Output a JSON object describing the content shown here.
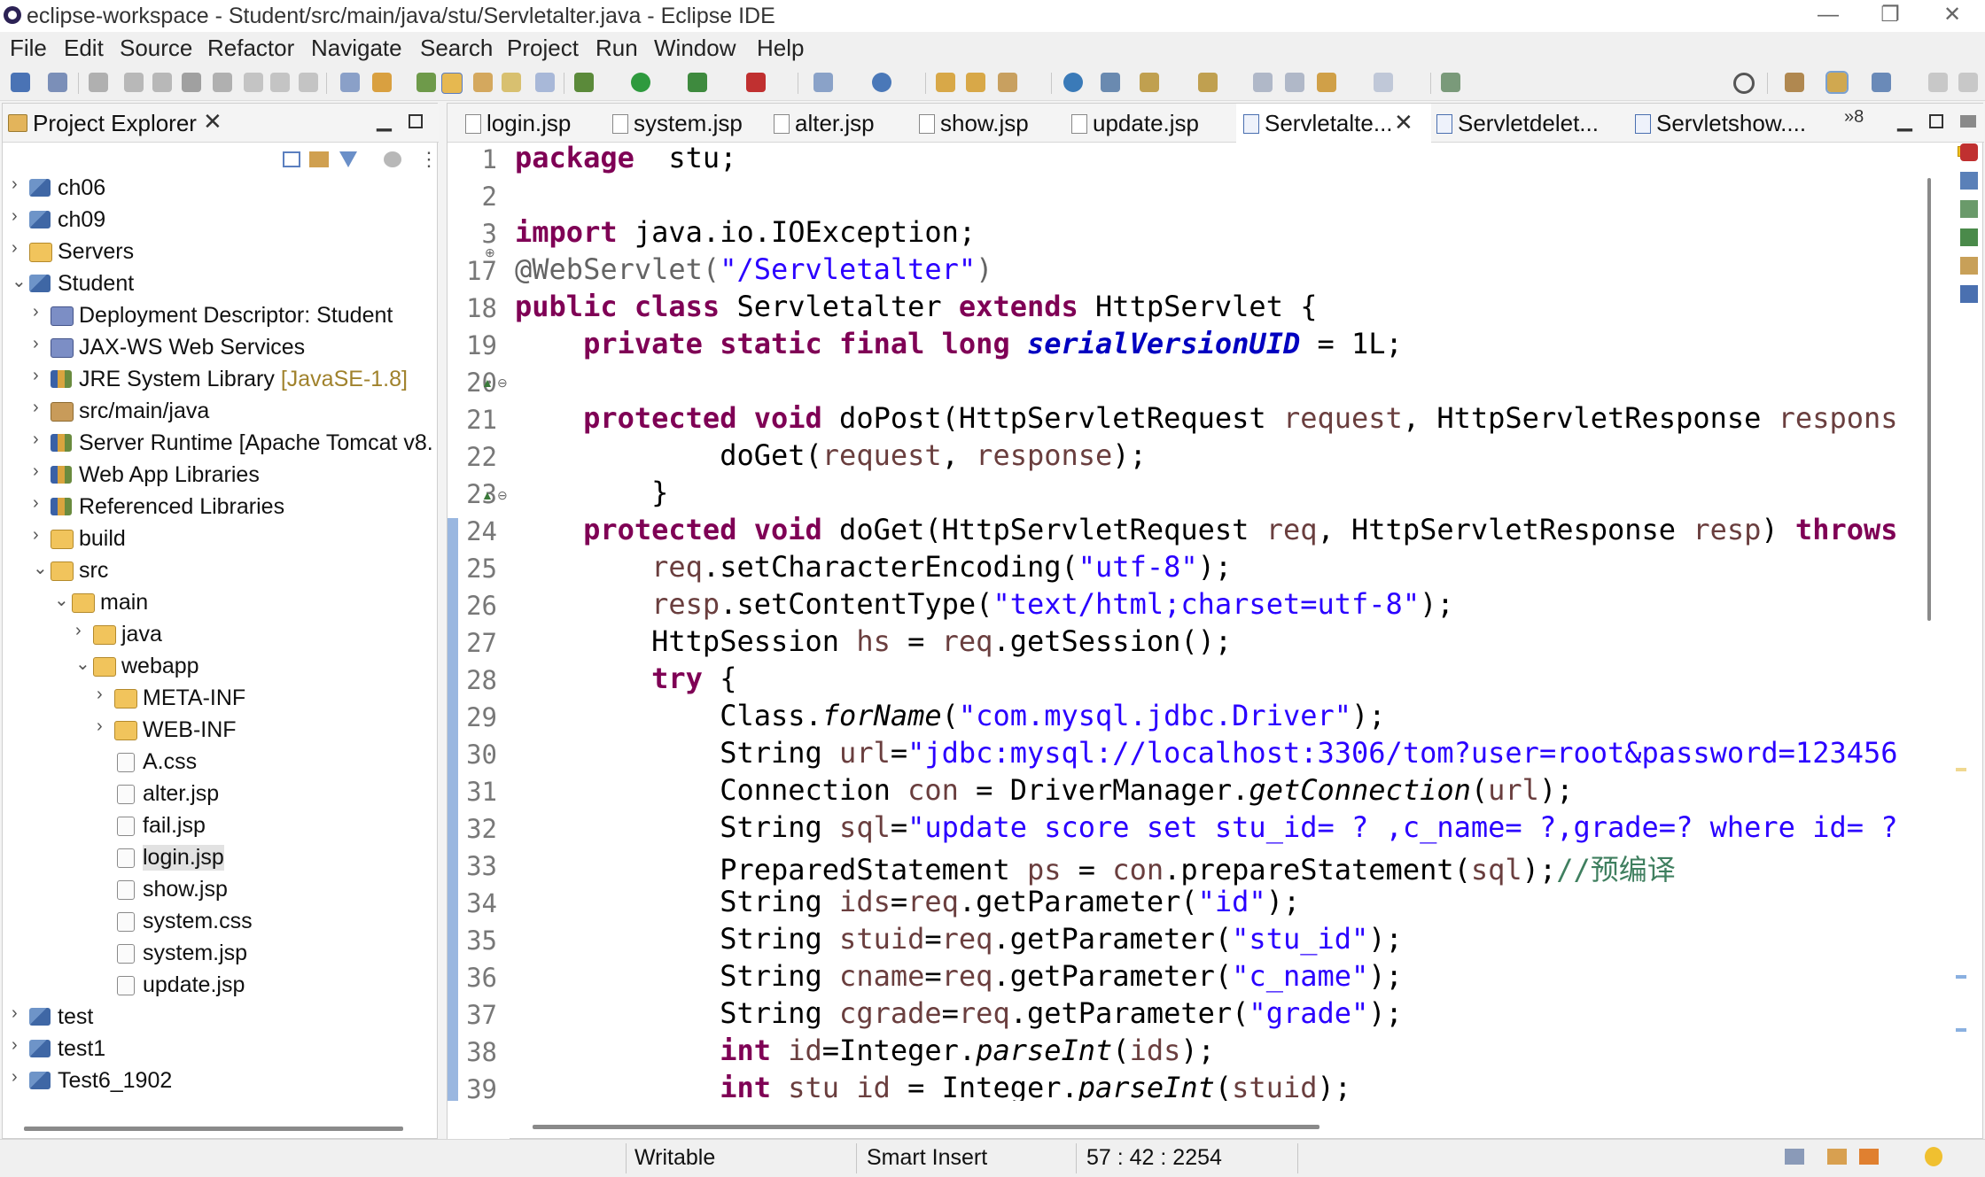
{
  "window": {
    "title": "eclipse-workspace - Student/src/main/java/stu/Servletalter.java - Eclipse IDE",
    "minimize": "—",
    "restore": "❐",
    "close": "✕"
  },
  "menu": [
    "File",
    "Edit",
    "Source",
    "Refactor",
    "Navigate",
    "Search",
    "Project",
    "Run",
    "Window",
    "Help"
  ],
  "explorer": {
    "title": "Project Explorer",
    "close": "✕",
    "tree": [
      {
        "label": "ch06",
        "icon": "project-icon",
        "twisty": "›"
      },
      {
        "label": "ch09",
        "icon": "project-icon",
        "twisty": "›"
      },
      {
        "label": "Servers",
        "icon": "folder-icon",
        "twisty": "›"
      },
      {
        "label": "Student",
        "icon": "project-icon",
        "twisty": "⌄"
      },
      {
        "label": "Deployment Descriptor: Student",
        "icon": "web-icon",
        "twisty": "›"
      },
      {
        "label": "JAX-WS Web Services",
        "icon": "web-icon",
        "twisty": "›"
      },
      {
        "label": "JRE System Library",
        "decoration": "[JavaSE-1.8]",
        "icon": "library-icon",
        "twisty": "›"
      },
      {
        "label": "src/main/java",
        "icon": "package-icon",
        "twisty": "›"
      },
      {
        "label": "Server Runtime [Apache Tomcat v8.",
        "icon": "library-icon",
        "twisty": "›"
      },
      {
        "label": "Web App Libraries",
        "icon": "library-icon",
        "twisty": "›"
      },
      {
        "label": "Referenced Libraries",
        "icon": "library-icon",
        "twisty": "›"
      },
      {
        "label": "build",
        "icon": "folder-icon",
        "twisty": "›"
      },
      {
        "label": "src",
        "icon": "folder-icon",
        "twisty": "⌄"
      },
      {
        "label": "main",
        "icon": "folder-icon",
        "twisty": "⌄"
      },
      {
        "label": "java",
        "icon": "folder-icon",
        "twisty": "›"
      },
      {
        "label": "webapp",
        "icon": "folder-icon",
        "twisty": "⌄"
      },
      {
        "label": "META-INF",
        "icon": "folder-icon",
        "twisty": "›"
      },
      {
        "label": "WEB-INF",
        "icon": "folder-icon",
        "twisty": "›"
      },
      {
        "label": "A.css",
        "icon": "file-icon",
        "twisty": ""
      },
      {
        "label": "alter.jsp",
        "icon": "file-icon",
        "twisty": ""
      },
      {
        "label": "fail.jsp",
        "icon": "file-icon",
        "twisty": ""
      },
      {
        "label": "login.jsp",
        "icon": "file-icon",
        "twisty": "",
        "selected": true
      },
      {
        "label": "show.jsp",
        "icon": "file-icon",
        "twisty": ""
      },
      {
        "label": "system.css",
        "icon": "file-icon",
        "twisty": ""
      },
      {
        "label": "system.jsp",
        "icon": "file-icon",
        "twisty": ""
      },
      {
        "label": "update.jsp",
        "icon": "file-icon",
        "twisty": ""
      },
      {
        "label": "test",
        "icon": "project-icon",
        "twisty": "›"
      },
      {
        "label": "test1",
        "icon": "project-icon",
        "twisty": "›"
      },
      {
        "label": "Test6_1902",
        "icon": "project-icon",
        "twisty": "›"
      }
    ]
  },
  "editor": {
    "tabs": [
      {
        "label": "login.jsp"
      },
      {
        "label": "system.jsp"
      },
      {
        "label": "alter.jsp"
      },
      {
        "label": "show.jsp"
      },
      {
        "label": "update.jsp"
      },
      {
        "label": "Servletalte...",
        "active": true,
        "close": "✕"
      },
      {
        "label": "Servletdelet..."
      },
      {
        "label": "Servletshow...."
      }
    ],
    "overflow": "»8",
    "line_numbers": [
      "1",
      "2",
      "3",
      "17",
      "18",
      "19",
      "20",
      "21",
      "22",
      "23",
      "24",
      "25",
      "26",
      "27",
      "28",
      "29",
      "30",
      "31",
      "32",
      "33",
      "34",
      "35",
      "36",
      "37",
      "38",
      "39"
    ],
    "code": [
      [
        [
          "kw",
          "package"
        ],
        [
          "",
          "  stu;"
        ]
      ],
      [],
      [
        [
          "kw",
          "import"
        ],
        [
          "",
          " java.io.IOException;"
        ]
      ],
      [
        [
          "ann",
          "@WebServlet("
        ],
        [
          "str",
          "\"/Servletalter\""
        ],
        [
          "ann",
          ")"
        ]
      ],
      [
        [
          "kw",
          "public"
        ],
        [
          "",
          " "
        ],
        [
          "kw",
          "class"
        ],
        [
          "",
          " Servletalter "
        ],
        [
          "kw",
          "extends"
        ],
        [
          "",
          " HttpServlet {"
        ]
      ],
      [
        [
          "",
          "    "
        ],
        [
          "kw",
          "private"
        ],
        [
          "",
          " "
        ],
        [
          "kw",
          "static"
        ],
        [
          "",
          " "
        ],
        [
          "kw",
          "final"
        ],
        [
          "",
          " "
        ],
        [
          "kw",
          "long"
        ],
        [
          "",
          " "
        ],
        [
          "fld",
          "serialVersionUID"
        ],
        [
          "",
          " = 1L;"
        ]
      ],
      [],
      [
        [
          "",
          "    "
        ],
        [
          "kw",
          "protected"
        ],
        [
          "",
          " "
        ],
        [
          "kw",
          "void"
        ],
        [
          "",
          " doPost(HttpServletRequest "
        ],
        [
          "var",
          "request"
        ],
        [
          "",
          ", HttpServletResponse "
        ],
        [
          "var",
          "respons"
        ]
      ],
      [
        [
          "",
          "            doGet("
        ],
        [
          "var",
          "request"
        ],
        [
          "",
          ", "
        ],
        [
          "var",
          "response"
        ],
        [
          "",
          ");"
        ]
      ],
      [
        [
          "",
          "        }"
        ]
      ],
      [
        [
          "",
          "    "
        ],
        [
          "kw",
          "protected"
        ],
        [
          "",
          " "
        ],
        [
          "kw",
          "void"
        ],
        [
          "",
          " doGet(HttpServletRequest "
        ],
        [
          "var",
          "req"
        ],
        [
          "",
          ", HttpServletResponse "
        ],
        [
          "var",
          "resp"
        ],
        [
          "",
          ") "
        ],
        [
          "kw",
          "throws"
        ]
      ],
      [
        [
          "",
          "        "
        ],
        [
          "var",
          "req"
        ],
        [
          "",
          ".setCharacterEncoding("
        ],
        [
          "str",
          "\"utf-8\""
        ],
        [
          "",
          ");"
        ]
      ],
      [
        [
          "",
          "        "
        ],
        [
          "var",
          "resp"
        ],
        [
          "",
          ".setContentType("
        ],
        [
          "str",
          "\"text/html;charset=utf-8\""
        ],
        [
          "",
          ");"
        ]
      ],
      [
        [
          "",
          "        HttpSession "
        ],
        [
          "var",
          "hs"
        ],
        [
          "",
          " = "
        ],
        [
          "var",
          "req"
        ],
        [
          "",
          ".getSession();"
        ]
      ],
      [
        [
          "",
          "        "
        ],
        [
          "kw",
          "try"
        ],
        [
          "",
          " {"
        ]
      ],
      [
        [
          "",
          "            Class."
        ],
        [
          "it",
          "forName"
        ],
        [
          "",
          "("
        ],
        [
          "str",
          "\"com.mysql.jdbc.Driver\""
        ],
        [
          "",
          ");"
        ]
      ],
      [
        [
          "",
          "            String "
        ],
        [
          "var",
          "url"
        ],
        [
          "",
          "="
        ],
        [
          "str",
          "\"jdbc:mysql://localhost:3306/tom?user=root&password=123456"
        ]
      ],
      [
        [
          "",
          "            Connection "
        ],
        [
          "var",
          "con"
        ],
        [
          "",
          " = DriverManager."
        ],
        [
          "it",
          "getConnection"
        ],
        [
          "",
          "("
        ],
        [
          "var",
          "url"
        ],
        [
          "",
          ");"
        ]
      ],
      [
        [
          "",
          "            String "
        ],
        [
          "var",
          "sql"
        ],
        [
          "",
          "="
        ],
        [
          "str",
          "\"update score set stu_id= ? ,c_name= ?,grade=? where id= ?"
        ]
      ],
      [
        [
          "",
          "            PreparedStatement "
        ],
        [
          "var",
          "ps"
        ],
        [
          "",
          " = "
        ],
        [
          "var",
          "con"
        ],
        [
          "",
          ".prepareStatement("
        ],
        [
          "var",
          "sql"
        ],
        [
          "",
          ");"
        ],
        [
          "cmt",
          "//预编译"
        ]
      ],
      [
        [
          "",
          "            String "
        ],
        [
          "var",
          "ids"
        ],
        [
          "",
          "="
        ],
        [
          "var",
          "req"
        ],
        [
          "",
          ".getParameter("
        ],
        [
          "str",
          "\"id\""
        ],
        [
          "",
          ");"
        ]
      ],
      [
        [
          "",
          "            String "
        ],
        [
          "var",
          "stuid"
        ],
        [
          "",
          "="
        ],
        [
          "var",
          "req"
        ],
        [
          "",
          ".getParameter("
        ],
        [
          "str",
          "\"stu_id\""
        ],
        [
          "",
          ");"
        ]
      ],
      [
        [
          "",
          "            String "
        ],
        [
          "var",
          "cname"
        ],
        [
          "",
          "="
        ],
        [
          "var",
          "req"
        ],
        [
          "",
          ".getParameter("
        ],
        [
          "str",
          "\"c_name\""
        ],
        [
          "",
          ");"
        ]
      ],
      [
        [
          "",
          "            String "
        ],
        [
          "var",
          "cgrade"
        ],
        [
          "",
          "="
        ],
        [
          "var",
          "req"
        ],
        [
          "",
          ".getParameter("
        ],
        [
          "str",
          "\"grade\""
        ],
        [
          "",
          ");"
        ]
      ],
      [
        [
          "",
          "            "
        ],
        [
          "kw",
          "int"
        ],
        [
          "",
          " "
        ],
        [
          "var",
          "id"
        ],
        [
          "",
          "=Integer."
        ],
        [
          "it",
          "parseInt"
        ],
        [
          "",
          "("
        ],
        [
          "var",
          "ids"
        ],
        [
          "",
          ");"
        ]
      ],
      [
        [
          "",
          "            "
        ],
        [
          "kw",
          "int"
        ],
        [
          "",
          " "
        ],
        [
          "var",
          "stu_id"
        ],
        [
          "",
          " = Integer."
        ],
        [
          "it",
          "parseInt"
        ],
        [
          "",
          "("
        ],
        [
          "var",
          "stuid"
        ],
        [
          "",
          ");"
        ]
      ]
    ]
  },
  "status": {
    "writable": "Writable",
    "insert_mode": "Smart Insert",
    "position": "57 : 42 : 2254"
  },
  "colors": {
    "keyword": "#7f0055",
    "string": "#2a00ff",
    "variable": "#6a3e3e",
    "field": "#0000c0",
    "comment": "#3f7f5f",
    "annotation": "#646464"
  }
}
